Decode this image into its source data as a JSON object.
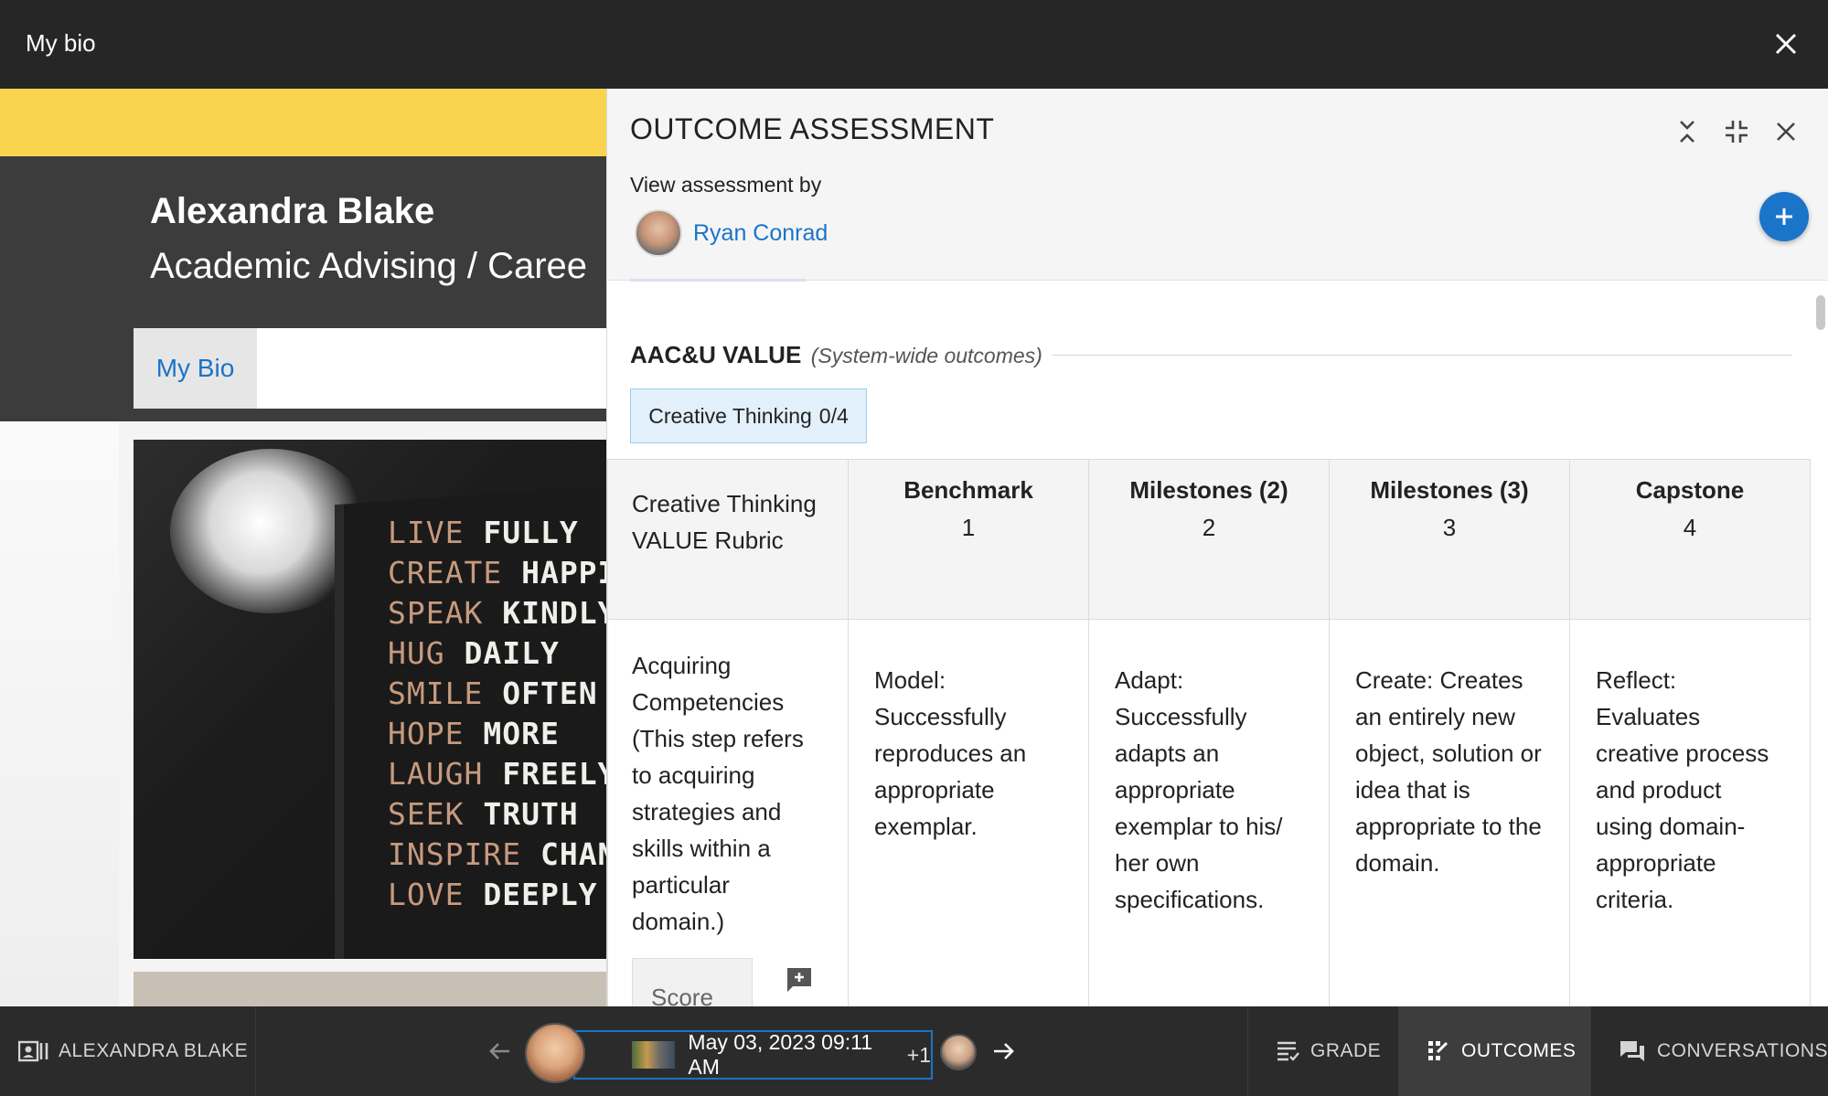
{
  "topbar": {
    "title": "My bio"
  },
  "background_page": {
    "name": "Alexandra Blake",
    "role": "Academic Advising / Caree",
    "tab_label": "My Bio",
    "poster_lines": [
      [
        "LIVE",
        "FULLY"
      ],
      [
        "CREATE",
        "HAPPIN"
      ],
      [
        "SPEAK",
        "KINDLY"
      ],
      [
        "HUG",
        "DAILY"
      ],
      [
        "SMILE",
        "OFTEN"
      ],
      [
        "HOPE",
        "MORE"
      ],
      [
        "LAUGH",
        "FREELY"
      ],
      [
        "SEEK",
        "TRUTH"
      ],
      [
        "INSPIRE",
        "CHANG"
      ],
      [
        "LOVE",
        "DEEPLY"
      ]
    ]
  },
  "panel": {
    "title": "OUTCOME ASSESSMENT",
    "view_by_label": "View assessment by",
    "assessor_name": "Ryan Conrad",
    "section_name": "AAC&U VALUE",
    "section_sub": "(System-wide outcomes)",
    "outcome_pill": {
      "name": "Creative Thinking",
      "score": "0/4"
    },
    "rubric": {
      "title": "Creative Thinking VALUE Rubric",
      "levels": [
        {
          "name": "Benchmark",
          "value": "1"
        },
        {
          "name": "Milestones (2)",
          "value": "2"
        },
        {
          "name": "Milestones (3)",
          "value": "3"
        },
        {
          "name": "Capstone",
          "value": "4"
        }
      ],
      "rows": [
        {
          "criterion": "Acquiring Competencies (This step refers to acquiring strategies and skills within a particular domain.)",
          "score_placeholder": "Score",
          "cells": [
            "Model: Successfully reproduces an appropriate exemplar.",
            "Adapt: Successfully adapts an appropriate exemplar to his/ her own specifications.",
            "Create: Creates an entirely new object, solution or idea that is appropriate to the domain.",
            "Reflect: Evaluates creative process and product using domain-appropriate criteria."
          ]
        }
      ]
    }
  },
  "bottombar": {
    "student_name": "ALEXANDRA BLAKE",
    "session_date": "May 03, 2023 09:11 AM",
    "session_more": "+1",
    "tabs": {
      "grade": "GRADE",
      "outcomes": "OUTCOMES",
      "conversations": "CONVERSATIONS"
    }
  },
  "colors": {
    "accent": "#1a74c9",
    "highlight": "#fbd44f",
    "topbar": "#262626",
    "bottombar": "#2b2b2b"
  }
}
